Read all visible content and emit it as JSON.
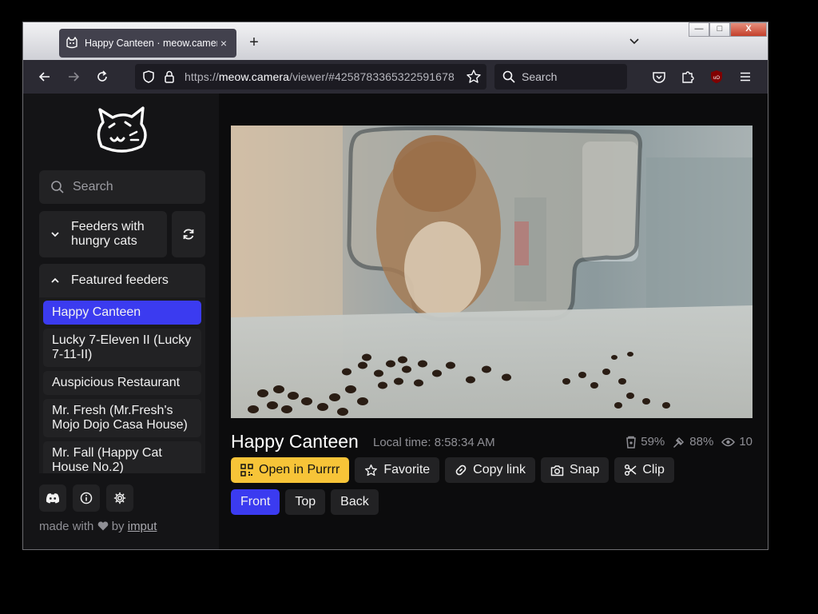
{
  "browser": {
    "tab_title": "Happy Canteen · meow.camera",
    "url_prefix": "https://",
    "url_domain": "meow.camera",
    "url_path": "/viewer/#4258783365322591678",
    "search_placeholder": "Search",
    "new_tab_symbol": "+",
    "tab_close_symbol": "×"
  },
  "window_controls": {
    "minimize": "—",
    "maximize": "□",
    "close": "X"
  },
  "sidebar": {
    "search_placeholder": "Search",
    "group_label": "Feeders with hungry cats",
    "featured_label": "Featured feeders",
    "feeders": [
      {
        "label": "Happy Canteen",
        "active": true
      },
      {
        "label": "Lucky 7-Eleven II (Lucky 7-11-II)"
      },
      {
        "label": "Auspicious Restaurant"
      },
      {
        "label": "Mr. Fresh (Mr.Fresh's Mojo Dojo Casa House)"
      },
      {
        "label": "Mr. Fall (Happy Cat House No.2)"
      }
    ],
    "made_with_prefix": "made with",
    "made_with_by": "by",
    "made_with_link": "imput"
  },
  "viewer": {
    "title": "Happy Canteen",
    "local_time": "Local time: 8:58:34 AM",
    "stats": {
      "food": "59%",
      "battery": "88%",
      "viewers": "10"
    },
    "buttons": {
      "open": "Open in Purrrr",
      "favorite": "Favorite",
      "copy": "Copy link",
      "snap": "Snap",
      "clip": "Clip"
    },
    "views": [
      "Front",
      "Top",
      "Back"
    ]
  },
  "colors": {
    "accent": "#3b3bf0",
    "primary_button": "#f7c438"
  }
}
